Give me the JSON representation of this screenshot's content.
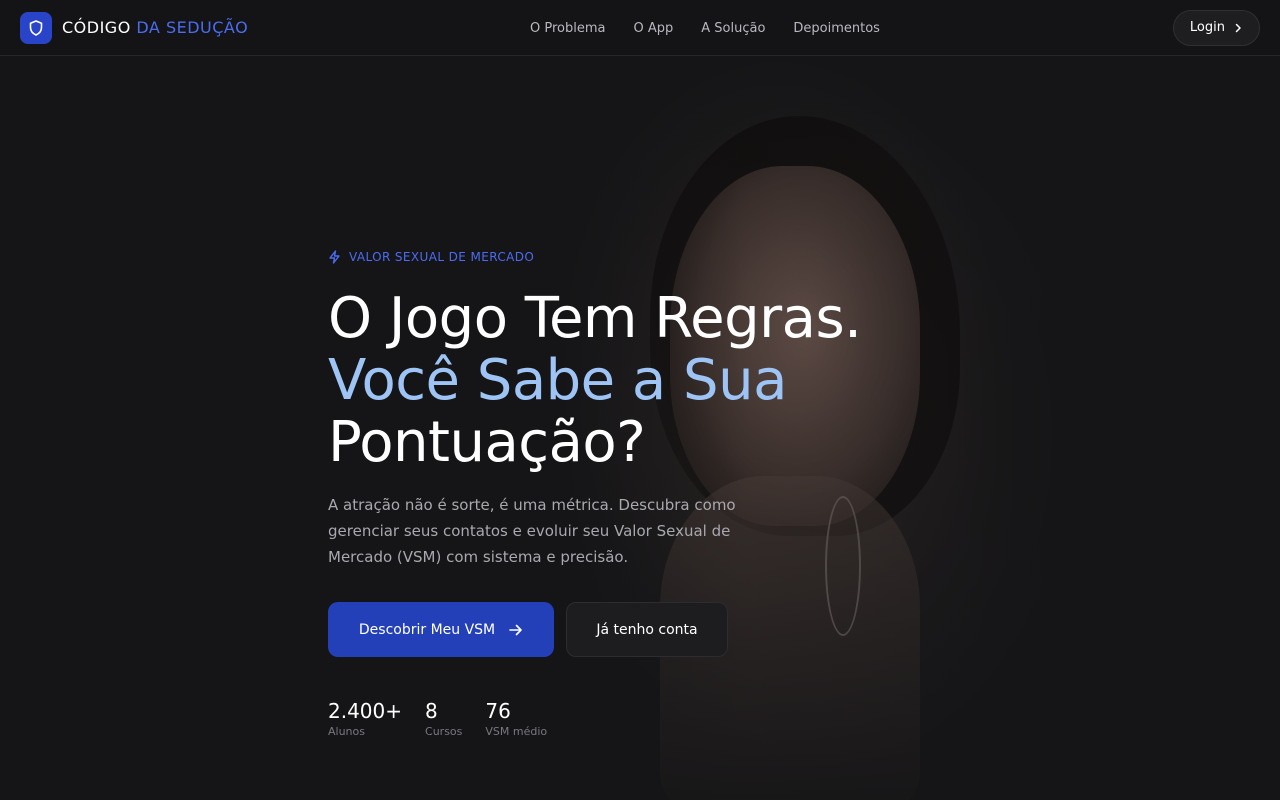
{
  "brand": {
    "name_part1": "CÓDIGO",
    "name_part2": "DA SEDUÇÃO",
    "logo_icon": "shield-icon"
  },
  "nav": {
    "links": [
      "O Problema",
      "O App",
      "A Solução",
      "Depoimentos"
    ],
    "login_label": "Login"
  },
  "hero": {
    "eyebrow": "VALOR SEXUAL DE MERCADO",
    "headline_line1": "O Jogo Tem Regras.",
    "headline_line2": "Você Sabe a Sua",
    "headline_line3": "Pontuação?",
    "lead": "A atração não é sorte, é uma métrica. Descubra como gerenciar seus contatos e evoluir seu Valor Sexual de Mercado (VSM) com sistema e precisão.",
    "primary_cta": "Descobrir Meu VSM",
    "secondary_cta": "Já tenho conta"
  },
  "stats": [
    {
      "value": "2.400+",
      "label": "Alunos"
    },
    {
      "value": "8",
      "label": "Cursos"
    },
    {
      "value": "76",
      "label": "VSM médio"
    }
  ],
  "colors": {
    "background": "#151517",
    "accent": "#4b6cf0",
    "primary_button": "#2340b8",
    "headline_accent": "#9ec4f5"
  }
}
